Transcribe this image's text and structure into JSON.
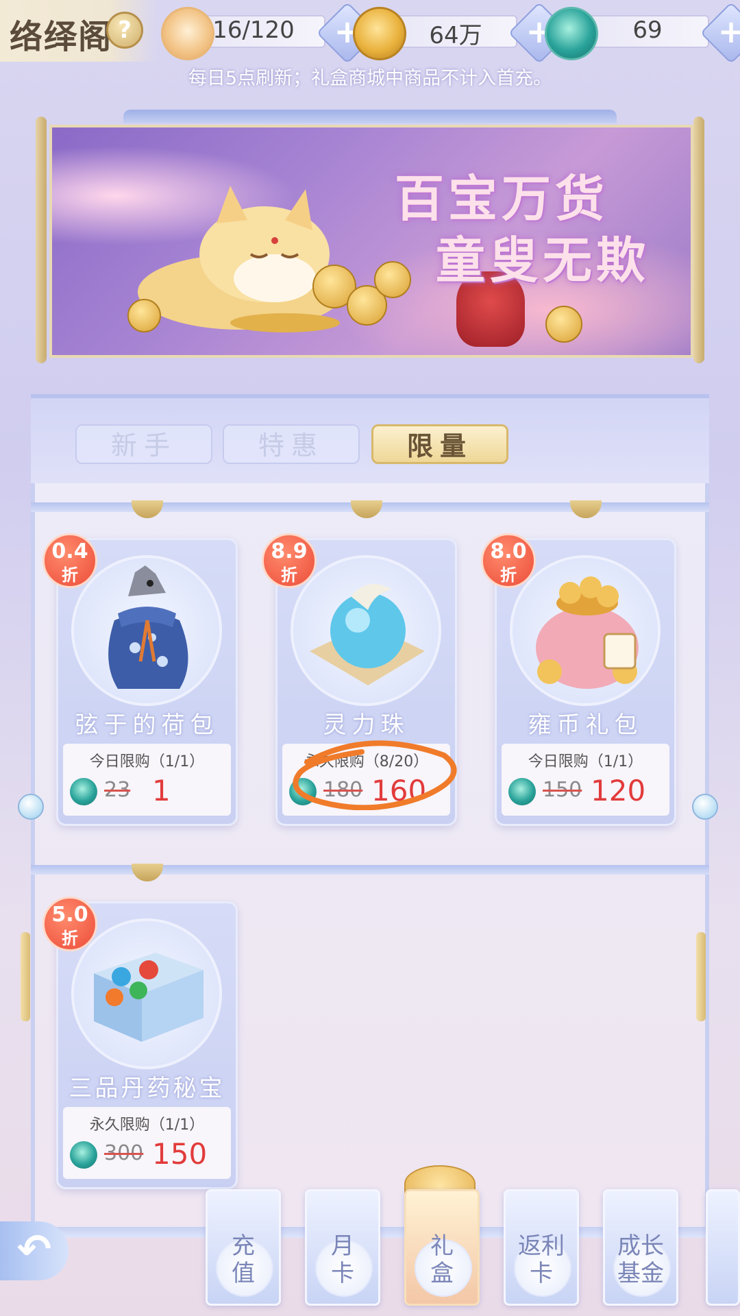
{
  "header": {
    "title": "络绎阁",
    "help_icon": "?",
    "resources": [
      {
        "name": "stamina",
        "icon": "cat-icon",
        "value": "16/120"
      },
      {
        "name": "coins",
        "icon": "coin-icon",
        "value": "64万"
      },
      {
        "name": "jade",
        "icon": "jade-icon",
        "value": "69"
      }
    ],
    "plus_label": "+"
  },
  "notice": "每日5点刷新；礼盒商城中商品不计入首充。",
  "banner": {
    "line1": "百宝万货",
    "line2": "童叟无欺"
  },
  "tabs": [
    {
      "label": "新手",
      "active": false
    },
    {
      "label": "特惠",
      "active": false
    },
    {
      "label": "限量",
      "active": true
    }
  ],
  "products": [
    {
      "discount": "0.4",
      "discount_unit": "折",
      "name": "弦于的荷包",
      "limit": "今日限购（1/1）",
      "original_price": "23",
      "price": "1",
      "icon": "pouch-icon"
    },
    {
      "discount": "8.9",
      "discount_unit": "折",
      "name": "灵力珠",
      "limit": "永久限购（8/20）",
      "original_price": "180",
      "price": "160",
      "icon": "orb-icon"
    },
    {
      "discount": "8.0",
      "discount_unit": "折",
      "name": "雍币礼包",
      "limit": "今日限购（1/1）",
      "original_price": "150",
      "price": "120",
      "icon": "coin-bag-icon"
    },
    {
      "discount": "5.0",
      "discount_unit": "折",
      "name": "三品丹药秘宝",
      "limit": "永久限购（1/1）",
      "original_price": "300",
      "price": "150",
      "icon": "pill-box-icon"
    }
  ],
  "bottom_nav": [
    {
      "label": "充值",
      "active": false
    },
    {
      "label": "月卡",
      "active": false
    },
    {
      "label": "礼盒",
      "active": true
    },
    {
      "label": "返利卡",
      "active": false
    },
    {
      "label": "成长基金",
      "active": false
    }
  ],
  "colors": {
    "price_red": "#e23b3b",
    "discount_badge": "#ec4c39",
    "annotation_orange": "#f07b2a",
    "tab_active_gold": "#efd797"
  }
}
